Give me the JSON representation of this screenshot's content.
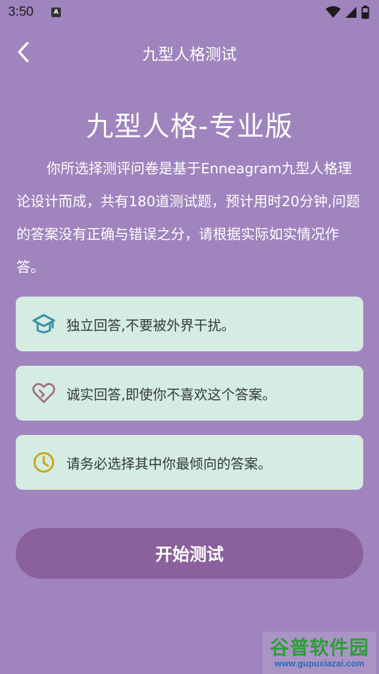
{
  "status_bar": {
    "time": "3:50",
    "app_icon_letter": "A"
  },
  "nav": {
    "title": "九型人格测试"
  },
  "main_title": "九型人格-专业版",
  "intro_text": "你所选择测评问卷是基于Enneagram九型人格理论设计而成，共有180道测试题，预计用时20分钟,问题的答案没有正确与错误之分，请根据实际如实情况作答。",
  "tips": [
    {
      "icon": "graduation-cap-icon",
      "text": "独立回答,不要被外界干扰。",
      "color": "#3a8fa3"
    },
    {
      "icon": "heart-icon",
      "text": "诚实回答,即使你不喜欢这个答案。",
      "color": "#a0707e"
    },
    {
      "icon": "clock-icon",
      "text": "请务必选择其中你最倾向的答案。",
      "color": "#c9a81a"
    }
  ],
  "start_button": "开始测试",
  "watermark": {
    "title": "谷普软件园",
    "url": "www.gupuxiazai.com"
  },
  "colors": {
    "background": "#9f84be",
    "card": "#d5ece2",
    "button": "#8a609d"
  }
}
